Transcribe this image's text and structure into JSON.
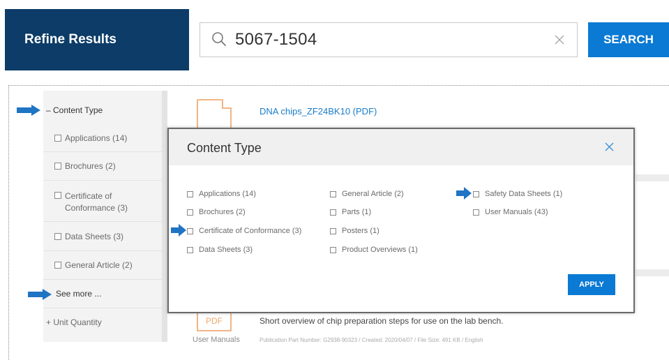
{
  "header": {
    "title": "Refine Results"
  },
  "search": {
    "query": "5067-1504",
    "button_label": "SEARCH"
  },
  "sidebar": {
    "heading": "– Content Type",
    "items": [
      {
        "label": "Applications (14)"
      },
      {
        "label": "Brochures (2)"
      },
      {
        "label": "Certificate of Conformance (3)"
      },
      {
        "label": "Data Sheets (3)"
      },
      {
        "label": "General Article (2)"
      }
    ],
    "see_more": "See more ...",
    "unit_quantity": "+ Unit Quantity"
  },
  "results": {
    "top_title": "DNA chips_ZF24BK10 (PDF)",
    "bottom_icon_label": "PDF",
    "bottom_caption": "User Manuals",
    "bottom_desc": "Short overview of chip preparation steps for use on the lab bench.",
    "bottom_meta": "Publication Part Number: G2938-90323  /  Created: 2020/04/07  /  File Size: 491 KB  /  English"
  },
  "modal": {
    "title": "Content Type",
    "columns": [
      [
        "Applications (14)",
        "Brochures (2)",
        "Certificate of Conformance (3)",
        "Data Sheets (3)"
      ],
      [
        "General Article (2)",
        "Parts (1)",
        "Posters (1)",
        "Product Overviews (1)"
      ],
      [
        "Safety Data Sheets (1)",
        "User Manuals (43)"
      ]
    ],
    "apply_label": "APPLY"
  },
  "colors": {
    "header_bg": "#0c3c67",
    "accent": "#0a7ad4",
    "arrow": "#1f74c4",
    "pdf_orange": "#f2b585"
  },
  "icons": [
    "search-icon",
    "clear-icon",
    "close-icon",
    "arrow-right-icon",
    "pdf-file-icon"
  ]
}
